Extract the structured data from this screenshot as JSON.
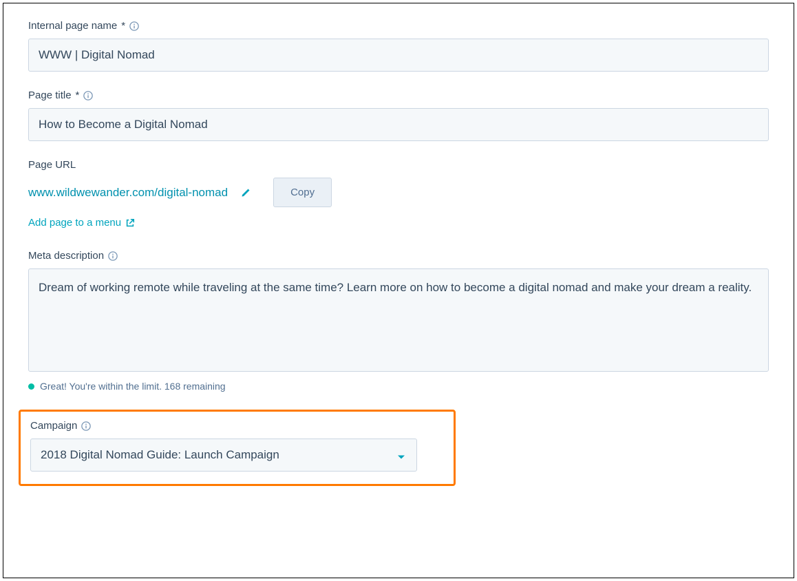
{
  "internalPageName": {
    "label": "Internal page name",
    "required": "*",
    "value": "WWW | Digital Nomad"
  },
  "pageTitle": {
    "label": "Page title",
    "required": "*",
    "value": "How to Become a Digital Nomad"
  },
  "pageUrl": {
    "label": "Page URL",
    "value": "www.wildwewander.com/digital-nomad",
    "copyLabel": "Copy",
    "addMenuLabel": "Add page to a menu"
  },
  "metaDescription": {
    "label": "Meta description",
    "value": "Dream of working remote while traveling at the same time? Learn more on how to become a digital nomad and make your dream a reality.",
    "statusText": "Great! You're within the limit. 168 remaining"
  },
  "campaign": {
    "label": "Campaign",
    "selected": "2018 Digital Nomad Guide: Launch Campaign"
  }
}
